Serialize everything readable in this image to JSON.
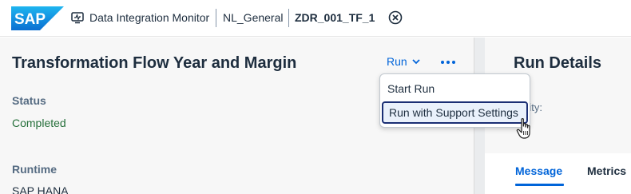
{
  "shell": {
    "logo_text": "SAP",
    "breadcrumb": [
      {
        "label": "Data Integration Monitor",
        "icon": "monitor-icon"
      },
      {
        "label": "NL_General"
      },
      {
        "label": "ZDR_001_TF_1"
      }
    ],
    "close_icon": "close-circle-icon"
  },
  "object": {
    "title": "Transformation Flow Year and Margin",
    "run_label": "Run",
    "more_icon": "overflow-icon",
    "status_label": "Status",
    "status_value": "Completed",
    "runtime_label": "Runtime",
    "runtime_value": "SAP HANA"
  },
  "menu": {
    "items": [
      {
        "label": "Start Run"
      },
      {
        "label": "Run with Support Settings",
        "focused": true
      }
    ]
  },
  "details": {
    "title": "Run Details",
    "activity_label": "ivity:",
    "tabs": [
      {
        "label": "Message",
        "active": true
      },
      {
        "label": "Metrics",
        "active": false
      }
    ]
  },
  "colors": {
    "brand": "#0064d9",
    "success": "#256f3a",
    "text": "#1d2d3e",
    "focus_border": "#1b2f74"
  }
}
